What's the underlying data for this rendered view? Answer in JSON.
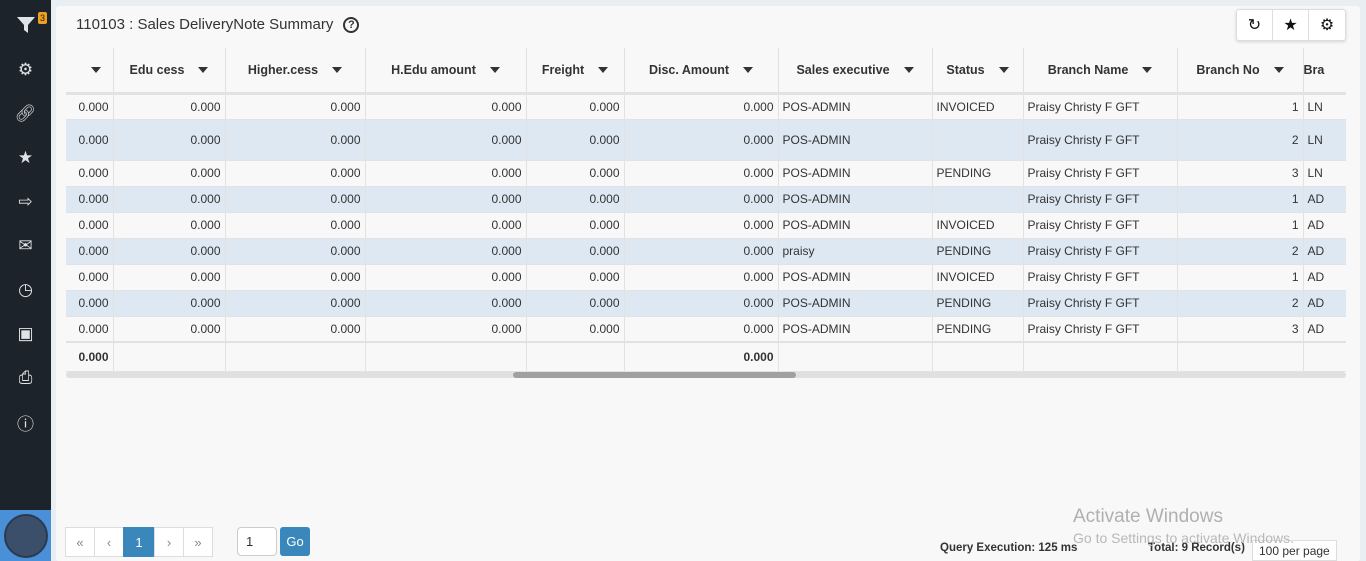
{
  "sidebar": {
    "filter_badge": "3",
    "icons": [
      "filter-icon",
      "gear-icon",
      "link-icon",
      "star-icon",
      "export-icon",
      "mail-icon",
      "clock-icon",
      "report-icon",
      "print-icon",
      "help-icon"
    ]
  },
  "header": {
    "title": "110103 : Sales DeliveryNote Summary",
    "help": "?"
  },
  "toolbar": {
    "refresh": "↻",
    "favorite": "★",
    "settings": "⚙"
  },
  "table": {
    "columns": [
      "",
      "Edu cess",
      "Higher.cess",
      "H.Edu amount",
      "Freight",
      "Disc. Amount",
      "Sales executive",
      "Status",
      "Branch Name",
      "Branch No",
      "Bra"
    ],
    "rows": [
      [
        "0.000",
        "0.000",
        "0.000",
        "0.000",
        "0.000",
        "0.000",
        "POS-ADMIN",
        "INVOICED",
        "Praisy Christy F GFT",
        "1",
        "LN"
      ],
      [
        "0.000",
        "0.000",
        "0.000",
        "0.000",
        "0.000",
        "0.000",
        "POS-ADMIN",
        "",
        "Praisy Christy F GFT",
        "2",
        "LN"
      ],
      [
        "0.000",
        "0.000",
        "0.000",
        "0.000",
        "0.000",
        "0.000",
        "POS-ADMIN",
        "PENDING",
        "Praisy Christy F GFT",
        "3",
        "LN"
      ],
      [
        "0.000",
        "0.000",
        "0.000",
        "0.000",
        "0.000",
        "0.000",
        "POS-ADMIN",
        "",
        "Praisy Christy F GFT",
        "1",
        "AD"
      ],
      [
        "0.000",
        "0.000",
        "0.000",
        "0.000",
        "0.000",
        "0.000",
        "POS-ADMIN",
        "INVOICED",
        "Praisy Christy F GFT",
        "1",
        "AD"
      ],
      [
        "0.000",
        "0.000",
        "0.000",
        "0.000",
        "0.000",
        "0.000",
        "praisy",
        "PENDING",
        "Praisy Christy F GFT",
        "2",
        "AD"
      ],
      [
        "0.000",
        "0.000",
        "0.000",
        "0.000",
        "0.000",
        "0.000",
        "POS-ADMIN",
        "INVOICED",
        "Praisy Christy F GFT",
        "1",
        "AD"
      ],
      [
        "0.000",
        "0.000",
        "0.000",
        "0.000",
        "0.000",
        "0.000",
        "POS-ADMIN",
        "PENDING",
        "Praisy Christy F GFT",
        "2",
        "AD"
      ],
      [
        "0.000",
        "0.000",
        "0.000",
        "0.000",
        "0.000",
        "0.000",
        "POS-ADMIN",
        "PENDING",
        "Praisy Christy F GFT",
        "3",
        "AD"
      ]
    ],
    "totals": [
      "0.000",
      "",
      "",
      "",
      "",
      "0.000",
      "",
      "",
      "",
      "",
      ""
    ]
  },
  "pager": {
    "first": "«",
    "prev": "‹",
    "current": "1",
    "next": "›",
    "last": "»",
    "page_input": "1",
    "go": "Go"
  },
  "footer": {
    "query_execution": "Query Execution: 125 ms",
    "total": "Total: 9 Record(s)",
    "per_page": "100 per page"
  },
  "watermark": {
    "line1": "Activate Windows",
    "line2": "Go to Settings to activate Windows."
  }
}
